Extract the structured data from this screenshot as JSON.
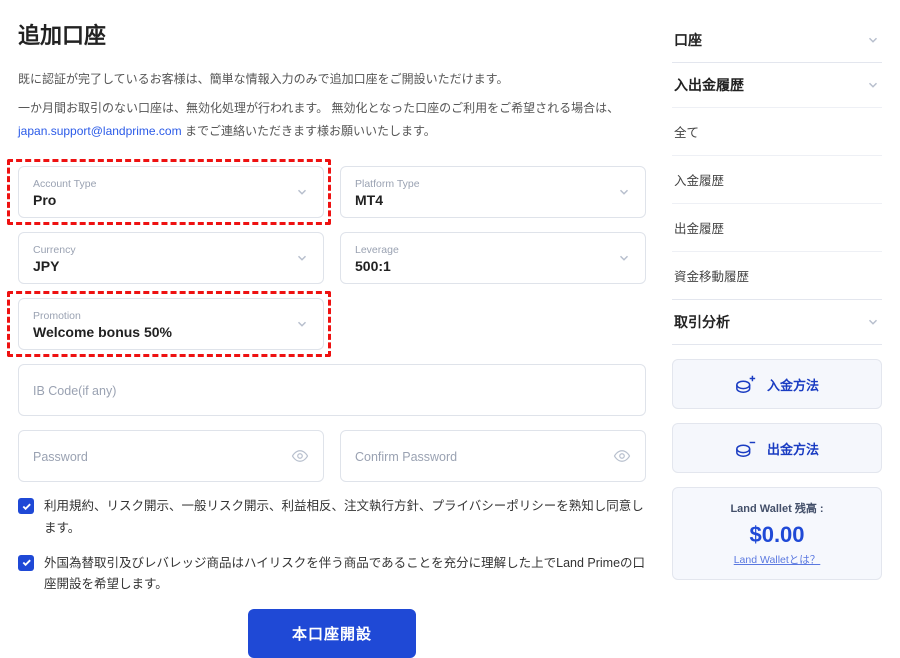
{
  "title": "追加口座",
  "desc_line1": "既に認証が完了しているお客様は、簡単な情報入力のみで追加口座をご開設いただけます。",
  "desc_line2a": "一か月間お取引のない口座は、無効化処理が行われます。 無効化となった口座のご利用をご希望される場合は、",
  "desc_email": "japan.support@landprime.com",
  "desc_line2b": " までご連絡いただきます様お願いいたします。",
  "fields": {
    "account_type": {
      "label": "Account Type",
      "value": "Pro"
    },
    "platform_type": {
      "label": "Platform Type",
      "value": "MT4"
    },
    "currency": {
      "label": "Currency",
      "value": "JPY"
    },
    "leverage": {
      "label": "Leverage",
      "value": "500:1"
    },
    "promotion": {
      "label": "Promotion",
      "value": "Welcome bonus 50%"
    },
    "ib_code": {
      "placeholder": "IB Code(if any)"
    },
    "password": {
      "placeholder": "Password"
    },
    "confirm_password": {
      "placeholder": "Confirm Password"
    }
  },
  "consent1": "利用規約、リスク開示、一般リスク開示、利益相反、注文執行方針、プライバシーポリシーを熟知し同意します。",
  "consent2": "外国為替取引及びレバレッジ商品はハイリスクを伴う商品であることを充分に理解した上でLand Primeの口座開設を希望します。",
  "submit_label": "本口座開設",
  "sidebar": {
    "account_head": "口座",
    "history_head": "入出金履歴",
    "history_items": [
      "全て",
      "入金履歴",
      "出金履歴",
      "資金移動履歴"
    ],
    "analysis_head": "取引分析",
    "deposit_action": "入金方法",
    "withdraw_action": "出金方法",
    "wallet_label": "Land Wallet 残高 :",
    "wallet_amount": "$0.00",
    "wallet_link": "Land Walletとは？"
  }
}
